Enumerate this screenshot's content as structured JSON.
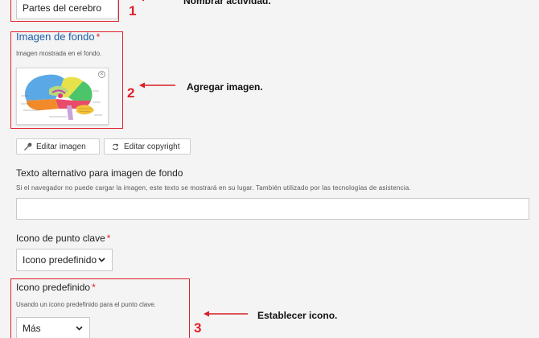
{
  "step1": {
    "number": "1",
    "input_value": "Partes del cerebro",
    "note": "Nombrar actividad."
  },
  "background_image": {
    "label": "Imagen de fondo",
    "required_mark": "*",
    "description": "Imagen mostrada en el fondo.",
    "remove_glyph": "×"
  },
  "step2": {
    "number": "2",
    "note": "Agregar imagen."
  },
  "image_buttons": {
    "edit_label": "Editar imagen",
    "copyright_label": "Editar copyright"
  },
  "alt_text": {
    "label": "Texto alternativo para imagen de fondo",
    "description": "Si el navegador no puede cargar la imagen, este texto se mostrará en su lugar. También utilizado por las tecnologías de asistencia.",
    "value": ""
  },
  "hotspot_icon": {
    "label": "Icono de punto clave",
    "required_mark": "*",
    "selected": "Icono predefinido"
  },
  "predefined_icon": {
    "label": "Icono predefinido",
    "required_mark": "*",
    "description": "Usando un icono predefinido para el punto clave.",
    "selected": "Más"
  },
  "step3": {
    "number": "3",
    "note": "Establecer icono."
  },
  "colors": {
    "annotation_red": "#e0202a",
    "label_blue": "#1c5ca8",
    "page_background": "#f4f4f4"
  },
  "icons": [
    "wrench-icon",
    "copyright-icon",
    "chevron-down-icon",
    "close-icon",
    "arrow-left-icon"
  ]
}
